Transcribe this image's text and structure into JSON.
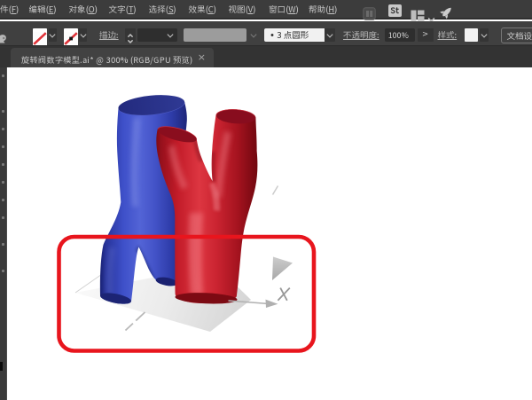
{
  "window": {
    "theme": {
      "menu_bg": "#3c3c3c",
      "control_bg": "#404040",
      "tabbar_bg": "#333333",
      "tab_bg": "#424242",
      "canvas_bg": "#ffffff",
      "accent_red": "#e8151d"
    }
  },
  "menu": {
    "items": [
      {
        "label": "文件(F)",
        "pre": "文件(",
        "key": "F",
        "post": ")"
      },
      {
        "label": "编辑(E)",
        "pre": "编辑(",
        "key": "E",
        "post": ")"
      },
      {
        "label": "对象(O)",
        "pre": "对象(",
        "key": "O",
        "post": ")"
      },
      {
        "label": "文字(T)",
        "pre": "文字(",
        "key": "T",
        "post": ")"
      },
      {
        "label": "选择(S)",
        "pre": "选择(",
        "key": "S",
        "post": ")"
      },
      {
        "label": "效果(C)",
        "pre": "效果(",
        "key": "C",
        "post": ")"
      },
      {
        "label": "视图(V)",
        "pre": "视图(",
        "key": "V",
        "post": ")"
      },
      {
        "label": "窗口(W)",
        "pre": "窗口(",
        "key": "W",
        "post": ")"
      },
      {
        "label": "帮助(H)",
        "pre": "帮助(",
        "key": "H",
        "post": ")"
      }
    ],
    "stock_badge": "St"
  },
  "control_bar": {
    "fill_swatch": "无",
    "stroke_swatch": "无",
    "stroke_label": "描边:",
    "stroke_weight_value": "",
    "brush_label": "3 点圆形",
    "opacity_label": "不透明度:",
    "opacity_value": "100%",
    "opacity_more": ">",
    "style_label": "样式:",
    "doc_setup_label": "文档设置"
  },
  "tab": {
    "title": "旋转阀数字模型.ai* @ 300% (RGB/GPU 预览)",
    "close": "×"
  },
  "canvas": {
    "zoom": "300%",
    "axis_label_x": "X",
    "annotation_color": "#e8151d"
  }
}
